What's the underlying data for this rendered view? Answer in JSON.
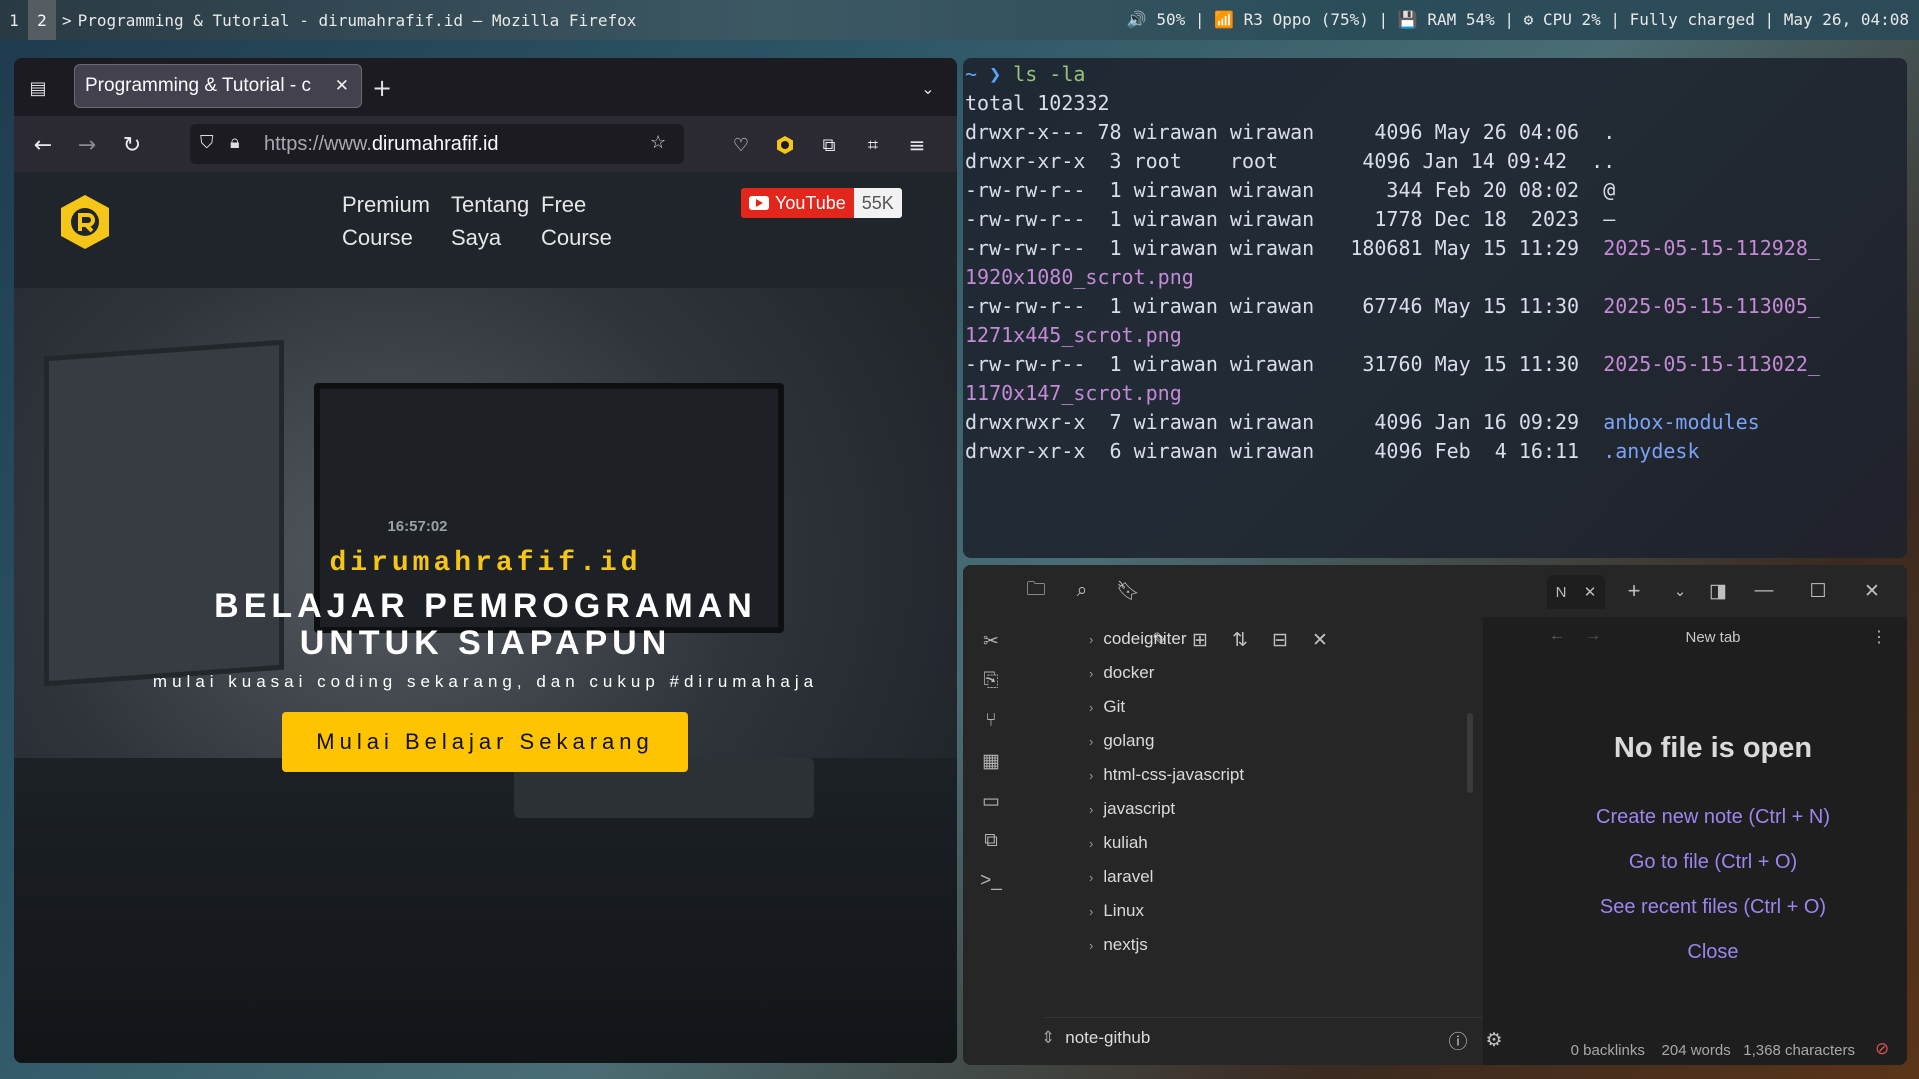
{
  "topbar": {
    "workspaces": [
      "1",
      "2"
    ],
    "separator": ">",
    "window_title": "Programming & Tutorial - dirumahrafif.id — Mozilla Firefox",
    "status": "🔊 50% | 📶 R3 Oppo (75%) | 💾 RAM 54% | ⚙ CPU 2% | Fully charged | May 26, 04:08"
  },
  "firefox": {
    "tab_title": "Programming & Tutorial - c",
    "url_prefix": "https://www.",
    "url_domain": "dirumahrafif.id",
    "site": {
      "menu": [
        {
          "line1": "Premium",
          "line2": "Course"
        },
        {
          "line1": "Tentang",
          "line2": "Saya"
        },
        {
          "line1": "Free",
          "line2": "Course"
        }
      ],
      "youtube_label": "YouTube",
      "youtube_count": "55K",
      "hero_site_name": "dirumahrafif.id",
      "hero_headline_1": "BELAJAR PEMROGRAMAN",
      "hero_headline_2": "UNTUK SIAPAPUN",
      "hero_tagline": "mulai kuasai coding sekarang, dan cukup #dirumahaja",
      "cta_label": "Mulai Belajar Sekarang",
      "clock_text": "16:57:02"
    }
  },
  "terminal": {
    "prompt_symbol": "~ ❯",
    "command": "ls -la",
    "total": "total 102332",
    "rows": [
      {
        "text": "drwxr-x--- 78 wirawan wirawan     4096 May 26 04:06  ",
        "name": "."
      },
      {
        "text": "drwxr-xr-x  3 root    root       4096 Jan 14 09:42  ",
        "name": ".."
      },
      {
        "text": "-rw-rw-r--  1 wirawan wirawan      344 Feb 20 08:02  ",
        "name": "@"
      },
      {
        "text": "-rw-rw-r--  1 wirawan wirawan     1778 Dec 18  2023  ",
        "name": "—"
      },
      {
        "text": "-rw-rw-r--  1 wirawan wirawan   180681 May 15 11:29  ",
        "name": "2025-05-15-112928_",
        "wrap": "1920x1080_scrot.png"
      },
      {
        "text": "-rw-rw-r--  1 wirawan wirawan    67746 May 15 11:30  ",
        "name": "2025-05-15-113005_",
        "wrap": "1271x445_scrot.png"
      },
      {
        "text": "-rw-rw-r--  1 wirawan wirawan    31760 May 15 11:30  ",
        "name": "2025-05-15-113022_",
        "wrap": "1170x147_scrot.png"
      },
      {
        "text": "drwxrwxr-x  7 wirawan wirawan     4096 Jan 16 09:29  ",
        "name": "anbox-modules"
      },
      {
        "text": "drwxr-xr-x  6 wirawan wirawan     4096 Feb  4 16:11  ",
        "name": ".anydesk"
      }
    ]
  },
  "obsidian": {
    "tab_label": "N",
    "new_tab_title": "New tab",
    "folders": [
      "codeigniter",
      "docker",
      "Git",
      "golang",
      "html-css-javascript",
      "javascript",
      "kuliah",
      "laravel",
      "Linux",
      "nextjs"
    ],
    "vault_name": "note-github",
    "empty_title": "No file is open",
    "actions": [
      "Create new note (Ctrl + N)",
      "Go to file (Ctrl + O)",
      "See recent files (Ctrl + O)",
      "Close"
    ],
    "status": {
      "backlinks": "0 backlinks",
      "words": "204 words",
      "chars": "1,368 characters"
    },
    "accent": "#9d85ee"
  }
}
